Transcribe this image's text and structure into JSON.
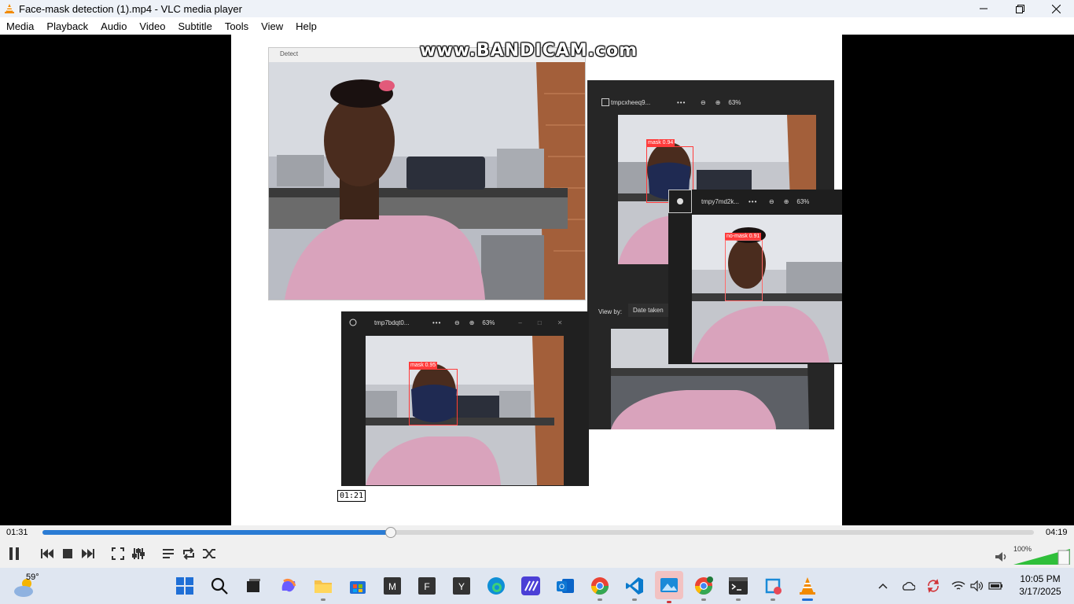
{
  "window": {
    "title": "Face-mask detection (1).mp4 - VLC media player"
  },
  "menu": [
    "Media",
    "Playback",
    "Audio",
    "Video",
    "Subtitle",
    "Tools",
    "View",
    "Help"
  ],
  "video": {
    "watermark": "www.BANDICAM.com",
    "detect_window_title": "Detect",
    "viewers": [
      {
        "filename": "tmpcxheeq9...",
        "zoom": "63%"
      },
      {
        "filename": "tmpy7md2k...",
        "zoom": "63%"
      },
      {
        "filename": "tmp7bdqt0...",
        "zoom": "63%"
      }
    ],
    "view_by_label": "View by:",
    "view_by_value": "Date taken",
    "detections": [
      {
        "label": "mask 0.94"
      },
      {
        "label": "no-mask 0.91"
      },
      {
        "label": "mask 0.95"
      }
    ],
    "hover_timestamp": "01:21"
  },
  "playback": {
    "elapsed": "01:31",
    "total": "04:19",
    "progress_fraction": 0.351,
    "volume": "100%",
    "volume_fraction": 1.0
  },
  "taskbar": {
    "weather_temp": "59°",
    "clock_time": "10:05 PM",
    "clock_date": "3/17/2025",
    "apps": [
      "start",
      "search",
      "task-view",
      "copilot",
      "file-explorer",
      "store",
      "m-app",
      "f-app",
      "y-app",
      "edge",
      "clipchamp",
      "outlook",
      "chrome-profile",
      "vscode",
      "photos",
      "chrome",
      "terminal",
      "snipping-tool",
      "vlc"
    ]
  },
  "colors": {
    "accent": "#2a7bd4",
    "vlc_orange": "#f18a00",
    "detection_red": "#ff3b3b",
    "volume_green": "#2fbf3a"
  }
}
